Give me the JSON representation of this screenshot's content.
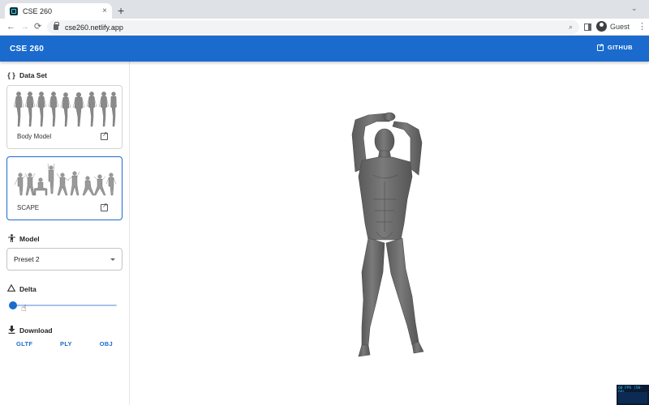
{
  "browser": {
    "tab_title": "CSE 260",
    "tab_close": "×",
    "new_tab": "+",
    "url": "cse260.netlify.app",
    "profile": "Guest",
    "back": "←",
    "forward": "→",
    "reload": "⟳",
    "menu": "⋮",
    "chevron": "⌄"
  },
  "app": {
    "title": "CSE 260",
    "github_label": "GITHUB",
    "accent_color": "#1a6bcd"
  },
  "sidebar": {
    "dataset": {
      "heading": "Data Set",
      "icon": "curly-braces-icon",
      "cards": [
        {
          "label": "Body Model",
          "selected": false
        },
        {
          "label": "SCAPE",
          "selected": true
        }
      ]
    },
    "model": {
      "heading": "Model",
      "icon": "person-icon",
      "selected": "Preset 2"
    },
    "delta": {
      "heading": "Delta",
      "icon": "triangle-icon",
      "value_fraction": 0.0
    },
    "download": {
      "heading": "Download",
      "icon": "download-icon",
      "formats": [
        "GLTF",
        "PLY",
        "OBJ"
      ]
    }
  },
  "stats": {
    "fps_label": "60 FPS (58-60)"
  }
}
